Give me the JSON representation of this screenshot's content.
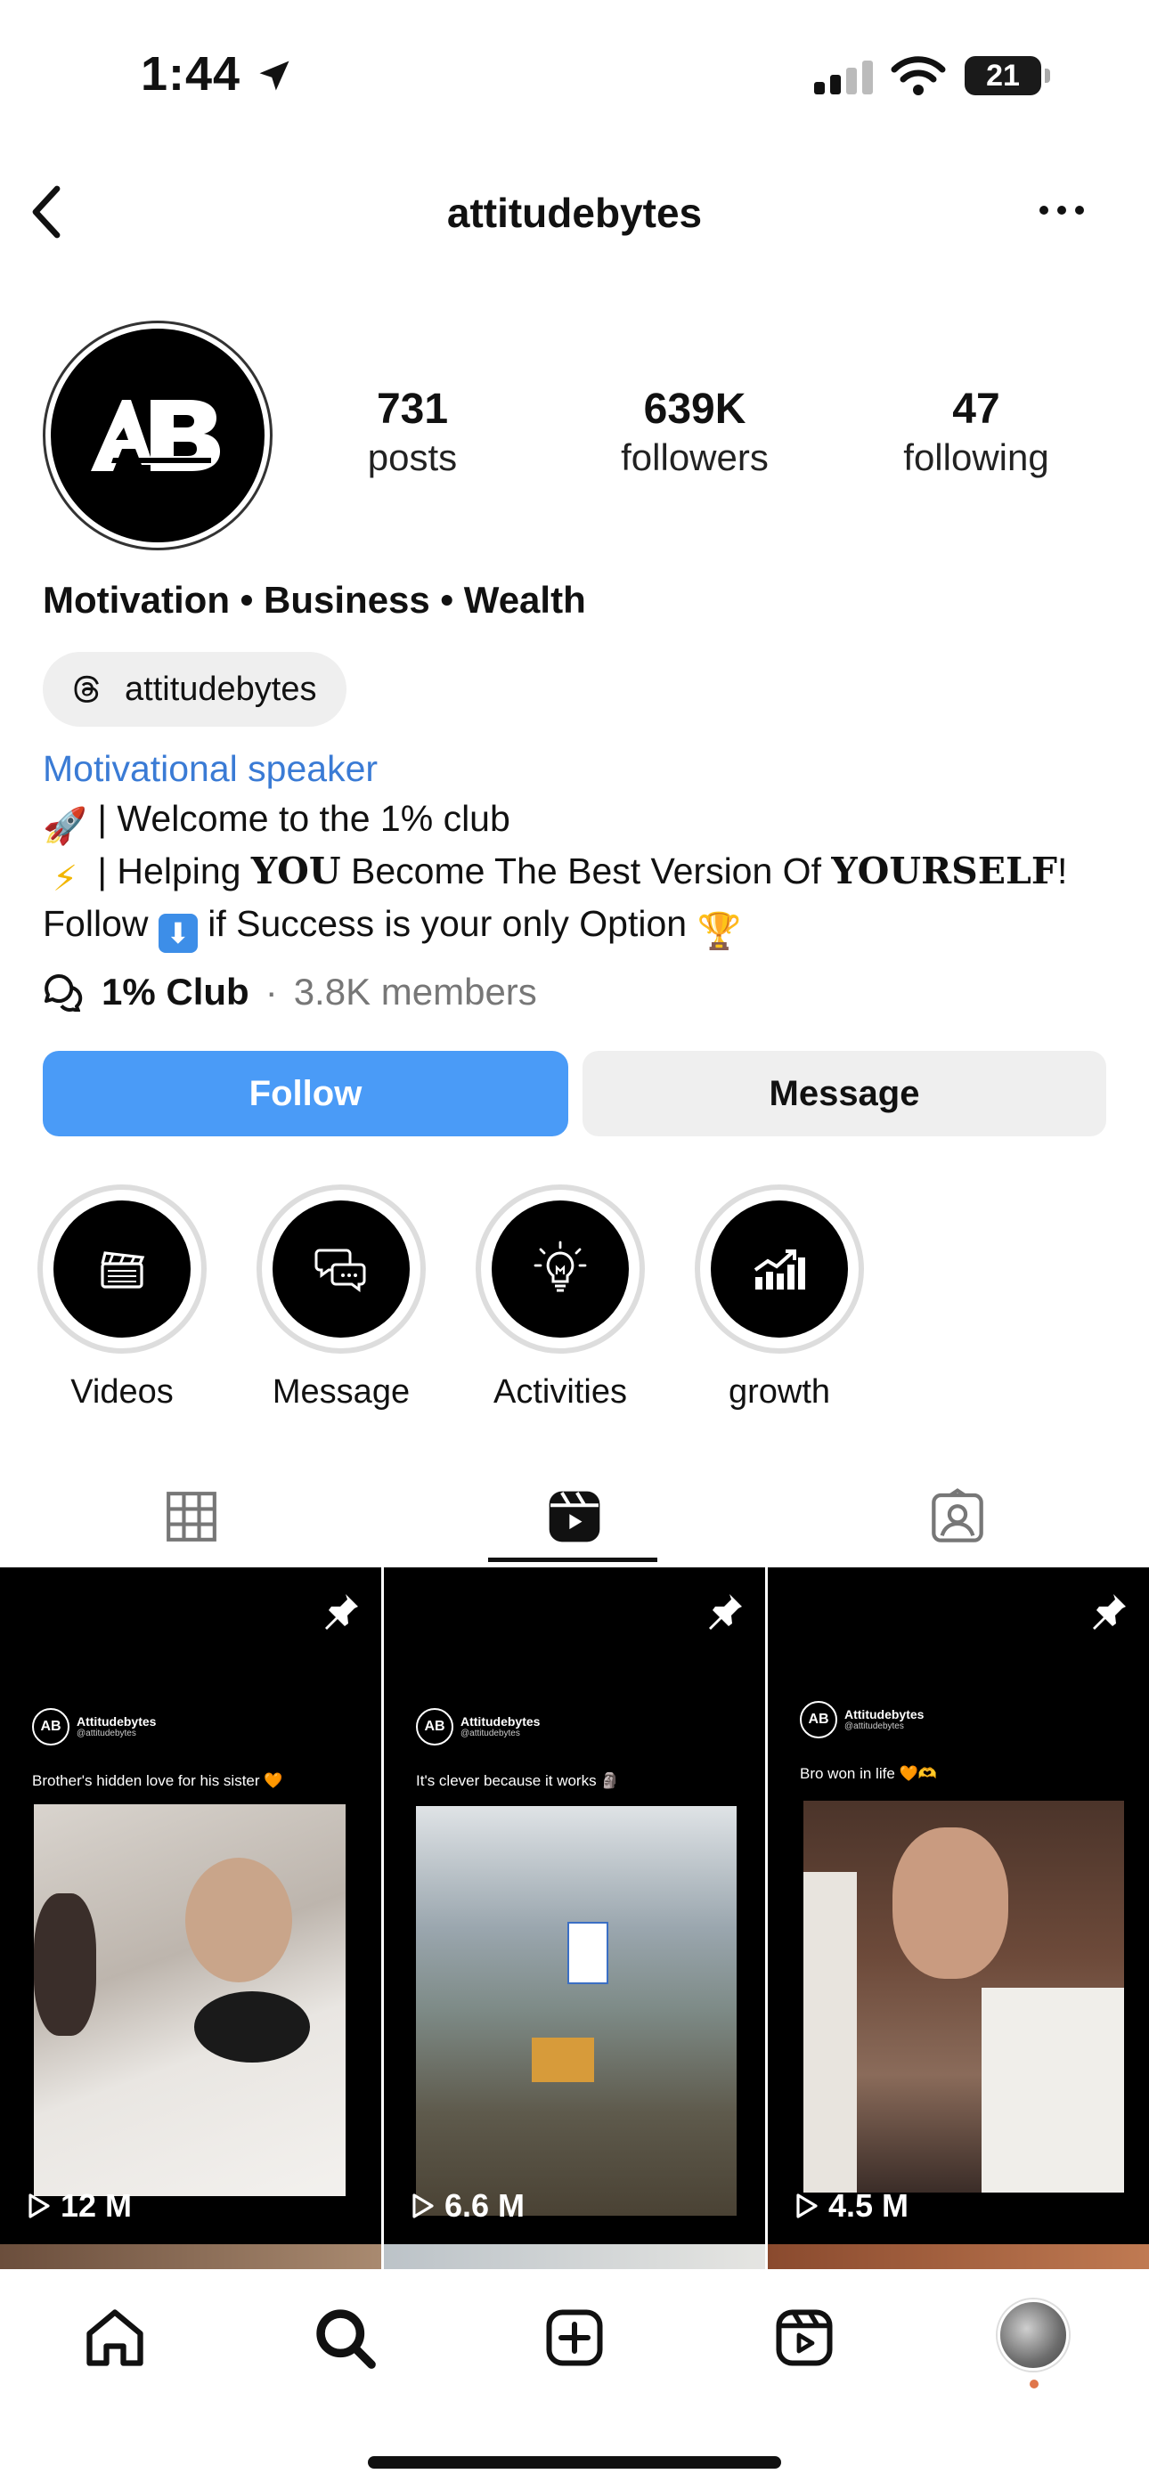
{
  "status": {
    "time": "1:44",
    "battery": "21"
  },
  "header": {
    "username": "attitudebytes"
  },
  "profile": {
    "avatar_text": "AB",
    "stats": [
      {
        "value": "731",
        "label": "posts"
      },
      {
        "value": "639K",
        "label": "followers"
      },
      {
        "value": "47",
        "label": "following"
      }
    ],
    "category": "Motivation • Business • Wealth",
    "threads_handle": "attitudebytes",
    "profession": "Motivational speaker",
    "bio": {
      "line1_emoji": "🚀",
      "line1": " | Welcome to the 1% club",
      "line2_emoji": "⚡",
      "line2_a": " | Helping ",
      "line2_b": "YOU",
      "line2_c": " Become The Best Version Of ",
      "line2_d": "YOURSELF",
      "line2_e": "!",
      "line3_a": "Follow ",
      "line3_emoji": "⬇",
      "line3_b": " if Success is your only Option ",
      "line3_emoji2": "🏆"
    },
    "channel": {
      "name": "1% Club",
      "separator": "·",
      "members": "3.8K members"
    }
  },
  "actions": {
    "follow": "Follow",
    "message": "Message"
  },
  "highlights": [
    {
      "label": "Videos",
      "icon": "clapperboard-icon"
    },
    {
      "label": "Message",
      "icon": "chat-bubbles-icon"
    },
    {
      "label": "Activities",
      "icon": "lightbulb-icon"
    },
    {
      "label": "growth",
      "icon": "growth-chart-icon"
    }
  ],
  "tabs": [
    "grid",
    "reels",
    "tagged"
  ],
  "reels": [
    {
      "account": "Attitudebytes",
      "handle": "@attitudebytes",
      "caption": "Brother's hidden love for his sister 🧡",
      "views": "12 M"
    },
    {
      "account": "Attitudebytes",
      "handle": "@attitudebytes",
      "caption": "It's clever because it works 🗿",
      "views": "6.6 M"
    },
    {
      "account": "Attitudebytes",
      "handle": "@attitudebytes",
      "caption": "Bro won in life 🧡🫶",
      "views": "4.5 M"
    }
  ],
  "colors": {
    "accent": "#4a9bf7",
    "link": "#3a7bd5",
    "badge": "#e0764a"
  }
}
